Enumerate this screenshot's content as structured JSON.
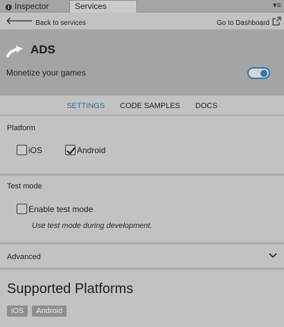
{
  "tabs": {
    "inspector": "Inspector",
    "services": "Services"
  },
  "nav": {
    "back": "Back to services",
    "dashboard": "Go to Dashboard"
  },
  "service": {
    "title": "ADS",
    "description": "Monetize your games",
    "enabled": true
  },
  "section_tabs": [
    "SETTINGS",
    "CODE SAMPLES",
    "DOCS"
  ],
  "platform": {
    "title": "Platform",
    "ios": {
      "label": "iOS",
      "checked": false
    },
    "android": {
      "label": "Android",
      "checked": true
    }
  },
  "test_mode": {
    "title": "Test mode",
    "checkbox_label": "Enable test mode",
    "checked": false,
    "hint": "Use test mode during development."
  },
  "advanced": {
    "label": "Advanced"
  },
  "supported": {
    "title": "Supported Platforms",
    "platforms": [
      "iOS",
      "Android"
    ]
  },
  "colors": {
    "accent": "#2f78a8",
    "header_bg": "#a4a4a4",
    "panel_bg": "#c2c2c2"
  }
}
